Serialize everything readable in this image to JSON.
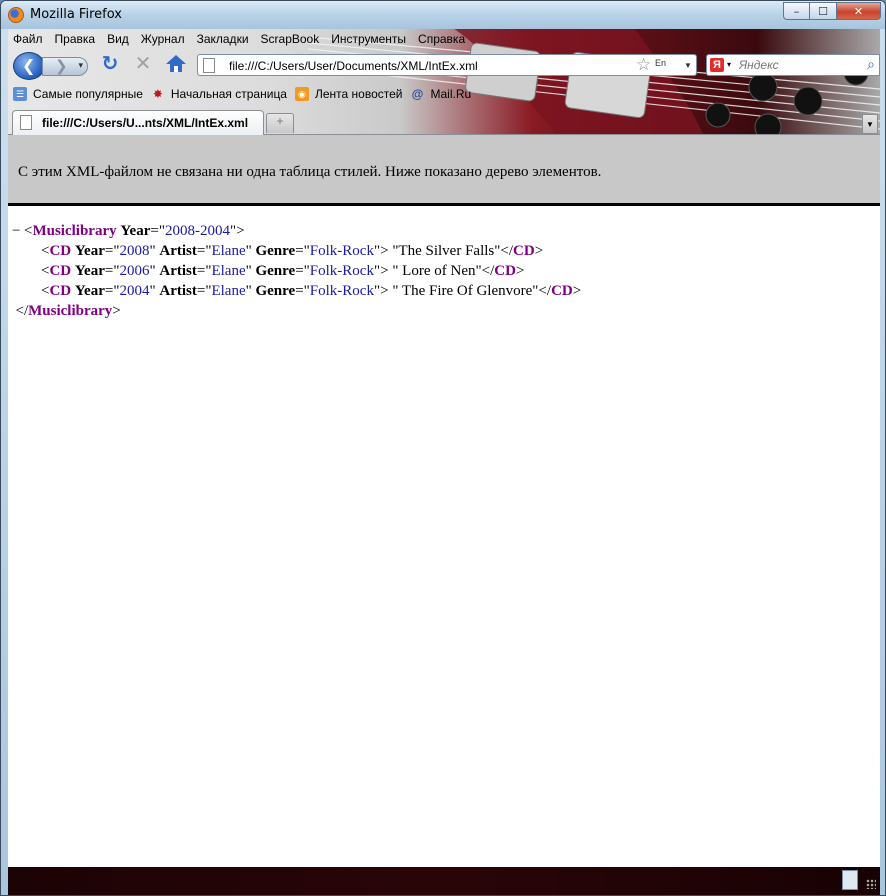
{
  "window": {
    "title": "Mozilla Firefox",
    "controls": {
      "minimize": "–",
      "maximize": "☐",
      "close": "✕"
    }
  },
  "menu": [
    "Файл",
    "Правка",
    "Вид",
    "Журнал",
    "Закладки",
    "ScrapBook",
    "Инструменты",
    "Справка"
  ],
  "nav": {
    "url": "file:///C:/Users/User/Documents/XML/IntEx.xml",
    "search_placeholder": "Яндекс",
    "search_engine": "Я",
    "lang_indicator": "En"
  },
  "bookmarks": [
    {
      "label": "Самые популярные",
      "icon": "most-visited-icon"
    },
    {
      "label": "Начальная страница",
      "icon": "start-page-icon"
    },
    {
      "label": "Лента новостей",
      "icon": "rss-icon"
    },
    {
      "label": "Mail.Ru",
      "icon": "mail-ru-icon"
    }
  ],
  "tabs": [
    {
      "label": "file:///C:/Users/U...nts/XML/IntEx.xml"
    }
  ],
  "content": {
    "info_text": "С этим XML-файлом не связана ни одна таблица стилей. Ниже показано дерево элементов.",
    "collapse_toggle": "−",
    "root": {
      "tag": "Musiclibrary",
      "attr_name": "Year",
      "attr_value": "2008-2004"
    },
    "cds": [
      {
        "tag": "CD",
        "year": "2008",
        "artist": "Elane",
        "genre": "Folk-Rock",
        "text": "\"The Silver Falls\""
      },
      {
        "tag": "CD",
        "year": "2006",
        "artist": "Elane",
        "genre": "Folk-Rock",
        "text": "\" Lore of Nen\""
      },
      {
        "tag": "CD",
        "year": "2004",
        "artist": "Elane",
        "genre": "Folk-Rock",
        "text": "\" The Fire Of Glenvore\""
      }
    ],
    "attr_labels": {
      "year": "Year",
      "artist": "Artist",
      "genre": "Genre"
    }
  }
}
